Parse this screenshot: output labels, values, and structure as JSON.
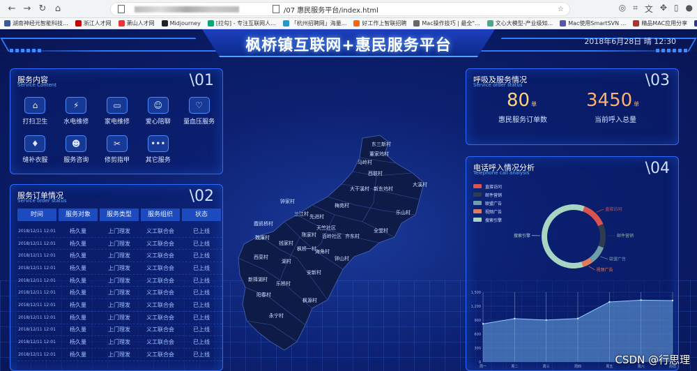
{
  "browser": {
    "url_text": "/07 惠民服务平台/index.html",
    "bookmarks": [
      {
        "label": "湖南神经元智能科技..."
      },
      {
        "label": "浙江人才网"
      },
      {
        "label": "萧山人才网"
      },
      {
        "label": "Midjourney"
      },
      {
        "label": "[拉勾] - 专注互联网人..."
      },
      {
        "label": "「杭州招聘网」海量..."
      },
      {
        "label": "好工作上智联招聘"
      },
      {
        "label": "Mac操作技巧 | 最全\"..."
      },
      {
        "label": "文心大模型-产业级知..."
      },
      {
        "label": "Mac使用SmartSVN ..."
      },
      {
        "label": "精品MAC应用分享"
      },
      {
        "label": "Macbook超级新手使..."
      },
      {
        "label": "其他书签"
      }
    ]
  },
  "header": {
    "title": "枫桥镇互联网+惠民服务平台",
    "datetime": "2018年6月28日  晴  12:30"
  },
  "services_panel": {
    "title": "服务内容",
    "subtitle": "Service Content",
    "index": "\\01",
    "items": [
      {
        "label": "打扫卫生",
        "icon": "⌂"
      },
      {
        "label": "水电维修",
        "icon": "⚡"
      },
      {
        "label": "家电维修",
        "icon": "▭"
      },
      {
        "label": "爱心陪聊",
        "icon": "☺"
      },
      {
        "label": "量血压服务",
        "icon": "♡"
      },
      {
        "label": "缝补衣服",
        "icon": "♦"
      },
      {
        "label": "服务咨询",
        "icon": "☻"
      },
      {
        "label": "修剪指甲",
        "icon": "✂"
      },
      {
        "label": "其它服务",
        "icon": "•••"
      }
    ]
  },
  "orders_panel": {
    "title": "服务订单情况",
    "subtitle": "Service order status",
    "index": "\\02",
    "columns": [
      "时间",
      "服务对象",
      "服务类型",
      "服务组织",
      "状态"
    ],
    "rows": [
      [
        "2018/12/11 12:01",
        "杨久量",
        "上门理发",
        "义工联合会",
        "已上线"
      ],
      [
        "2018/12/11 12:01",
        "杨久量",
        "上门理发",
        "义工联合会",
        "已上线"
      ],
      [
        "2018/12/11 12:01",
        "杨久量",
        "上门理发",
        "义工联合会",
        "已上线"
      ],
      [
        "2018/12/11 12:01",
        "杨久量",
        "上门理发",
        "义工联合会",
        "已上线"
      ],
      [
        "2018/12/11 12:01",
        "杨久量",
        "上门理发",
        "义工联合会",
        "已上线"
      ],
      [
        "2018/12/11 12:01",
        "杨久量",
        "上门理发",
        "义工联合会",
        "已上线"
      ],
      [
        "2018/12/11 12:01",
        "杨久量",
        "上门理发",
        "义工联合会",
        "已上线"
      ],
      [
        "2018/12/11 12:01",
        "杨久量",
        "上门理发",
        "义工联合会",
        "已上线"
      ],
      [
        "2018/12/11 12:01",
        "杨久量",
        "上门理发",
        "义工联合会",
        "已上线"
      ],
      [
        "2018/12/11 12:01",
        "杨久量",
        "上门理发",
        "义工联合会",
        "已上线"
      ],
      [
        "2018/12/11 12:01",
        "杨久量",
        "上门理发",
        "义工联合会",
        "已上线"
      ]
    ]
  },
  "map": {
    "villages": [
      "东三新村",
      "董家坞村",
      "马岭村",
      "西联村",
      "大溪村",
      "大干溪村",
      "新东坞村",
      "钟家村",
      "梅苑村",
      "乐山村",
      "先进村",
      "三江村",
      "霞凯桥村",
      "天竺社区",
      "陈家村",
      "百岭社区",
      "全堂村",
      "魏廉村",
      "齐东村",
      "钱家村",
      "枫桥一村",
      "西栾村",
      "海角村",
      "钟山村",
      "湖村",
      "新择湖村",
      "安新村",
      "乐桥村",
      "阳春村",
      "枫源村",
      "永宁村"
    ]
  },
  "calls_panel": {
    "title": "呼吸及服务情况",
    "subtitle": "Service order status",
    "index": "\\03",
    "orders_value": "80",
    "orders_unit": "单",
    "orders_caption": "惠民服务订单数",
    "calls_value": "3450",
    "calls_unit": "单",
    "calls_caption": "当前呼入总量"
  },
  "phone_panel": {
    "title": "电话呼入情况分析",
    "subtitle": "Telephone call analysis",
    "index": "\\04",
    "legend": [
      {
        "label": "直接访问",
        "color": "#d9534f"
      },
      {
        "label": "邮件营销",
        "color": "#2f3b4f"
      },
      {
        "label": "联盟广告",
        "color": "#6f9ea8"
      },
      {
        "label": "视频广告",
        "color": "#e07a5f"
      },
      {
        "label": "搜索引擎",
        "color": "#a8d5c2"
      }
    ]
  },
  "chart_data": [
    {
      "type": "pie",
      "title": "",
      "categories": [
        "直接访问",
        "邮件营销",
        "联盟广告",
        "视频广告",
        "搜索引擎"
      ],
      "values": [
        335,
        310,
        234,
        135,
        1548
      ],
      "labels_shown": [
        "直接访问",
        "邮件营销",
        "联盟广告",
        "视频广告",
        "搜索引擎"
      ],
      "colors": [
        "#d9534f",
        "#2f3b4f",
        "#6f9ea8",
        "#e07a5f",
        "#a8d5c2"
      ]
    },
    {
      "type": "area",
      "categories": [
        "周一",
        "周二",
        "周三",
        "周四",
        "周五",
        "周六",
        "周日"
      ],
      "values": [
        820,
        932,
        901,
        934,
        1290,
        1330,
        1320
      ],
      "ylim": [
        0,
        1500
      ],
      "yticks": [
        "0",
        "300",
        "600",
        "900",
        "1,200",
        "1,500"
      ],
      "ytick_values": [
        0,
        300,
        600,
        900,
        1200,
        1500
      ],
      "xlabel": "",
      "ylabel": "",
      "grid": true
    }
  ],
  "watermark": "CSDN @行思理"
}
